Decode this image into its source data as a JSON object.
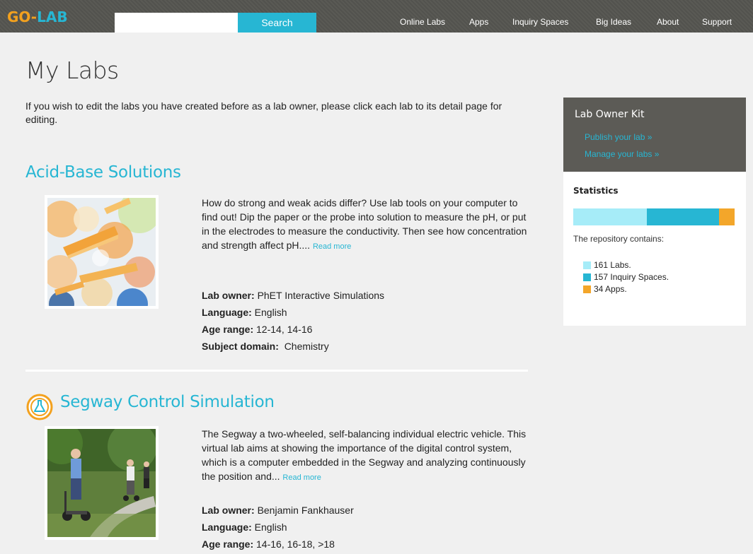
{
  "header": {
    "logo_go": "GO-",
    "logo_lab": "LAB",
    "search_placeholder": "",
    "search_button": "Search",
    "nav": [
      "Online Labs",
      "Apps",
      "Inquiry Spaces",
      "Big Ideas",
      "About",
      "Support"
    ]
  },
  "main": {
    "title": "My Labs",
    "intro": "If you wish to edit the labs you have created before as a lab owner, please click each lab to its detail page for editing.",
    "labs": [
      {
        "title": "Acid-Base Solutions",
        "description": "How do strong and weak acids differ? Use lab tools on your computer to find out! Dip the paper or the probe into solution to measure the pH, or put in the electrodes to measure the conductivity. Then see how concentration and strength affect pH....",
        "read_more": "Read more",
        "owner_label": "Lab owner:",
        "owner": "PhET Interactive Simulations",
        "language_label": "Language:",
        "language": "English",
        "age_label": "Age range:",
        "age": "12-14, 14-16",
        "subject_label": "Subject domain:",
        "subject": "Chemistry"
      },
      {
        "title": "Segway Control Simulation",
        "description": "The Segway a two-wheeled, self-balancing individual electric vehicle. This virtual lab aims at showing the importance of the digital control system, which is a computer embedded in the Segway and analyzing continuously the position and...",
        "read_more": "Read more",
        "owner_label": "Lab owner:",
        "owner": "Benjamin Fankhauser",
        "language_label": "Language:",
        "language": "English",
        "age_label": "Age range:",
        "age": "14-16, 16-18, >18"
      }
    ]
  },
  "sidebar": {
    "owner_kit": {
      "title": "Lab Owner Kit",
      "publish": "Publish your lab »",
      "manage": "Manage your labs »"
    },
    "statistics": {
      "title": "Statistics",
      "caption": "The repository contains:",
      "items": [
        {
          "label": "161 Labs.",
          "count": 161,
          "color": "#a6ecf8"
        },
        {
          "label": "157 Inquiry Spaces.",
          "count": 157,
          "color": "#27b6d3"
        },
        {
          "label": "34 Apps.",
          "count": 34,
          "color": "#f3a62a"
        }
      ]
    }
  }
}
